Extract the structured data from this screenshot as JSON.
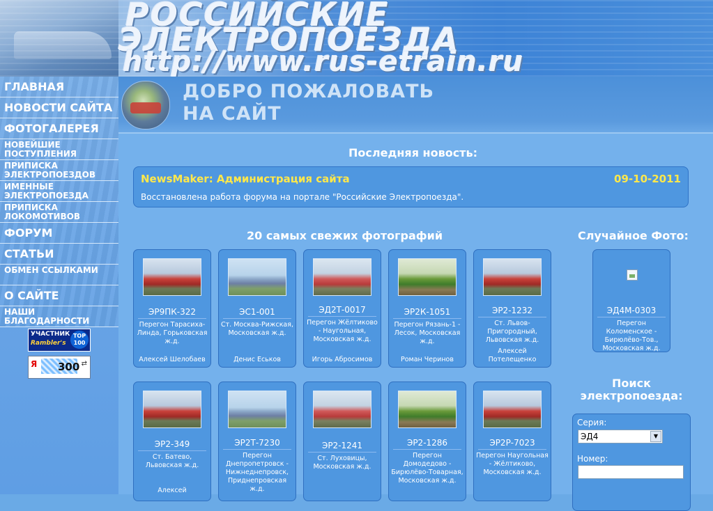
{
  "header": {
    "logo_line1": "РОССИЙСКИЕ",
    "logo_line2": "ЭЛЕКТРОПОЕЗДА",
    "logo_url": "http://www.rus-etrain.ru"
  },
  "welcome": {
    "line1": "ДОБРО ПОЖАЛОВАТЬ",
    "line2": "НА САЙТ"
  },
  "sidebar": {
    "items": [
      {
        "label": "ГЛАВНАЯ",
        "size": "big"
      },
      {
        "label": "НОВОСТИ САЙТА",
        "size": "big"
      },
      {
        "label": "ФОТОГАЛЕРЕЯ",
        "size": "big"
      },
      {
        "label": "НОВЕЙШИЕ ПОСТУПЛЕНИЯ",
        "size": "small"
      },
      {
        "label": "ПРИПИСКА ЭЛЕКТРОПОЕЗДОВ",
        "size": "small"
      },
      {
        "label": "ИМЕННЫЕ ЭЛЕКТРОПОЕЗДА",
        "size": "small"
      },
      {
        "label": "ПРИПИСКА ЛОКОМОТИВОВ",
        "size": "small"
      },
      {
        "label": "ФОРУМ",
        "size": "big"
      },
      {
        "label": "СТАТЬИ",
        "size": "big"
      },
      {
        "label": "ОБМЕН ССЫЛКАМИ",
        "size": "small"
      },
      {
        "label": "О САЙТЕ",
        "size": "big"
      },
      {
        "label": "НАШИ БЛАГОДАРНОСТИ",
        "size": "small"
      }
    ],
    "rambler": {
      "line1": "УЧАСТНИК",
      "line2": "Rambler's",
      "badge": "TOP 100"
    },
    "yandex": {
      "letter": "Я",
      "count": "300",
      "mark": "⇄"
    }
  },
  "news": {
    "heading": "Последняя новость:",
    "author": "NewsMaker: Администрация сайта",
    "date": "09-10-2011",
    "text": "Восстановлена работа форума на портале \"Российские Электропоезда\"."
  },
  "photos": {
    "heading": "20 самых свежих фотографий",
    "items": [
      {
        "name": "ЭР9ПК-322",
        "location": "Перегон Тарасиха-Линда, Горьковская ж.д.",
        "author": "Алексей Шелобаев",
        "thumb": "red"
      },
      {
        "name": "ЭС1-001",
        "location": "Ст. Москва-Рижская, Московская ж.д.",
        "author": "Денис Еськов",
        "thumb": "blue"
      },
      {
        "name": "ЭД2Т-0017",
        "location": "Перегон Жёлтиково - Наугольная, Московская ж.д.",
        "author": "Игорь Абросимов",
        "thumb": "pink"
      },
      {
        "name": "ЭР2К-1051",
        "location": "Перегон Рязань-1 - Лесок, Московская ж.д.",
        "author": "Роман Черинов",
        "thumb": "green"
      },
      {
        "name": "ЭР2-1232",
        "location": "Ст. Львов-Пригородный, Львовская ж.д.",
        "author": "Алексей Потелещенко",
        "thumb": "red"
      },
      {
        "name": "ЭР2-349",
        "location": "Ст. Батево, Львовская ж.д.",
        "author": "Алексей",
        "thumb": "red"
      },
      {
        "name": "ЭР2Т-7230",
        "location": "Перегон Днепропетровск - Нижнеднепровск, Приднепровская ж.д.",
        "author": "",
        "thumb": "blue"
      },
      {
        "name": "ЭР2-1241",
        "location": "Ст. Луховицы, Московская ж.д.",
        "author": "",
        "thumb": "pink"
      },
      {
        "name": "ЭР2-1286",
        "location": "Перегон Домодедово - Бирюлёво-Товарная, Московская ж.д.",
        "author": "",
        "thumb": "green"
      },
      {
        "name": "ЭР2Р-7023",
        "location": "Перегон Наугольная - Жёлтиково, Московская ж.д.",
        "author": "",
        "thumb": "red"
      }
    ]
  },
  "random_photo": {
    "heading": "Случайное Фото:",
    "name": "ЭД4М-0303",
    "location": "Перегон Коломенское - Бирюлёво-Тов., Московская ж.д."
  },
  "search": {
    "title": "Поиск электропоезда:",
    "series_label": "Серия:",
    "series_value": "ЭД4",
    "number_label": "Номер:",
    "number_value": ""
  }
}
